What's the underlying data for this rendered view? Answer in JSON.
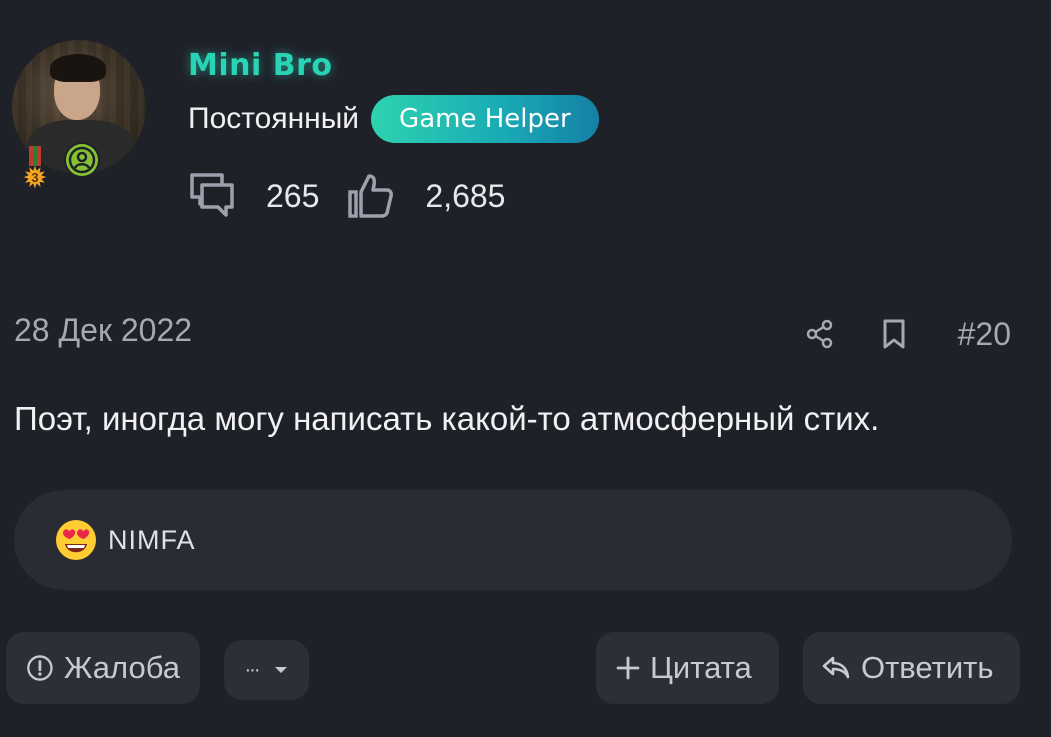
{
  "author": {
    "username": "Mini Bro",
    "user_title": "Постоянный",
    "role_badge": "Game Helper",
    "medal_number": "3",
    "messages_count": "265",
    "likes_count": "2,685"
  },
  "meta": {
    "date": "28 Дек 2022",
    "post_number": "#20"
  },
  "post": {
    "body": "Поэт, иногда могу написать какой-то атмосферный стих."
  },
  "reactions": [
    {
      "emoji": "heart-eyes-emoji",
      "user": "NIMFA"
    }
  ],
  "actions": {
    "report_label": "Жалоба",
    "more_label": "···",
    "quote_label": "Цитата",
    "reply_label": "Ответить"
  },
  "colors": {
    "background": "#1f2129",
    "username": "#29d3b6",
    "badge_gradient_start": "#2ed3b0",
    "badge_gradient_end": "#167fa6",
    "muted_text": "#a6a8b3",
    "button_bg": "#2d2f38",
    "reaction_bg": "#2a2c34"
  }
}
